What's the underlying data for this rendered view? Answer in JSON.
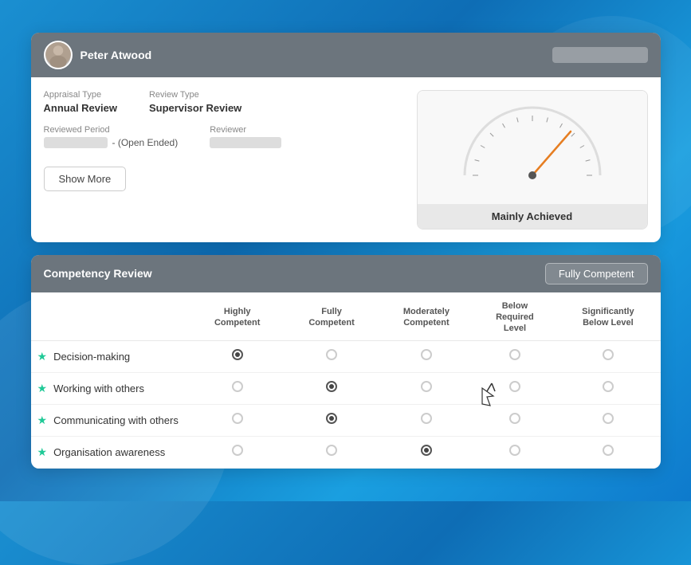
{
  "page": {
    "background_color": "#1a8fd1"
  },
  "top_card": {
    "header": {
      "user_name": "Peter Atwood"
    },
    "appraisal_type_label": "Appraisal Type",
    "appraisal_type_value": "Annual Review",
    "review_type_label": "Review Type",
    "review_type_value": "Supervisor Review",
    "reviewed_period_label": "Reviewed Period",
    "reviewed_period_suffix": "- (Open Ended)",
    "reviewer_label": "Reviewer",
    "show_more_label": "Show More",
    "gauge_label": "Mainly Achieved"
  },
  "bottom_card": {
    "header_title": "Competency Review",
    "badge_label": "Fully Competent",
    "columns": [
      "Highly Competent",
      "Fully Competent",
      "Moderately Competent",
      "Below Required Level",
      "Significantly Below Level"
    ],
    "rows": [
      {
        "name": "Decision-making",
        "selected_col": 0
      },
      {
        "name": "Working with others",
        "selected_col": 1
      },
      {
        "name": "Communicating with others",
        "selected_col": 1
      },
      {
        "name": "Organisation awareness",
        "selected_col": 2
      }
    ]
  }
}
